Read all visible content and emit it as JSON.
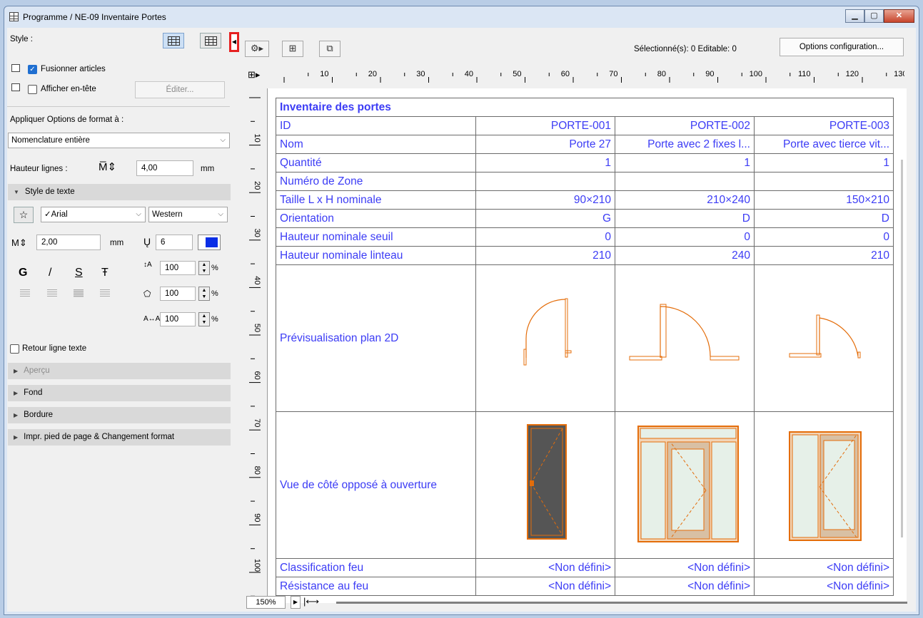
{
  "window": {
    "title": "Programme / NE-09 Inventaire Portes"
  },
  "left": {
    "style_label": "Style :",
    "merge_items": "Fusionner articles",
    "show_header": "Afficher en-tête",
    "edit_button": "Éditer...",
    "apply_format_label": "Appliquer Options de format à :",
    "apply_format_value": "Nomenclature entière",
    "row_height_label": "Hauteur lignes :",
    "row_height_value": "4,00",
    "unit_mm": "mm",
    "text_style_header": "Style de texte",
    "font_value": "✓Arial",
    "charset_value": "Western",
    "font_size": "2,00",
    "pen_value": "6",
    "text_color": "#0a2ee6",
    "bold_label": "G",
    "italic_label": "/",
    "underline_label": "S",
    "strike_label": "Ŧ",
    "line_spacing": "100",
    "char_width": "100",
    "char_spacing": "100",
    "percent": "%",
    "wrap_text": "Retour ligne texte",
    "sections": [
      "Aperçu",
      "Fond",
      "Bordure",
      "Impr. pied de page & Changement format"
    ]
  },
  "toolbar": {
    "selection_info": "Sélectionné(s): 0 Editable: 0",
    "options_button": "Options configuration..."
  },
  "ruler": {
    "h_ticks": [
      "10",
      "20",
      "30",
      "40",
      "50",
      "60",
      "70",
      "80",
      "90",
      "100",
      "110",
      "120",
      "130"
    ],
    "v_ticks": [
      "10",
      "20",
      "30",
      "40",
      "50",
      "60",
      "70",
      "80",
      "90",
      "100"
    ]
  },
  "schedule": {
    "title": "Inventaire des portes",
    "rows": [
      {
        "label": "ID",
        "values": [
          "PORTE-001",
          "PORTE-002",
          "PORTE-003"
        ]
      },
      {
        "label": "Nom",
        "values": [
          "Porte 27",
          "Porte avec 2 fixes l...",
          "Porte avec tierce vit..."
        ]
      },
      {
        "label": "Quantité",
        "values": [
          "1",
          "1",
          "1"
        ]
      },
      {
        "label": "Numéro de Zone",
        "values": [
          "",
          "",
          ""
        ]
      },
      {
        "label": "Taille L x H nominale",
        "values": [
          "90×210",
          "210×240",
          "150×210"
        ]
      },
      {
        "label": "Orientation",
        "values": [
          "G",
          "D",
          "D"
        ]
      },
      {
        "label": "Hauteur nominale seuil",
        "values": [
          "0",
          "0",
          "0"
        ]
      },
      {
        "label": "Hauteur nominale linteau",
        "values": [
          "210",
          "240",
          "210"
        ]
      }
    ],
    "preview_label": "Prévisualisation plan 2D",
    "side_view_label": "Vue de côté opposé à ouverture",
    "fire_rows": [
      {
        "label": "Classification feu",
        "values": [
          "<Non défini>",
          "<Non défini>",
          "<Non défini>"
        ]
      },
      {
        "label": "Résistance au feu",
        "values": [
          "<Non défini>",
          "<Non défini>",
          "<Non défini>"
        ]
      }
    ]
  },
  "status": {
    "zoom": "150%"
  }
}
